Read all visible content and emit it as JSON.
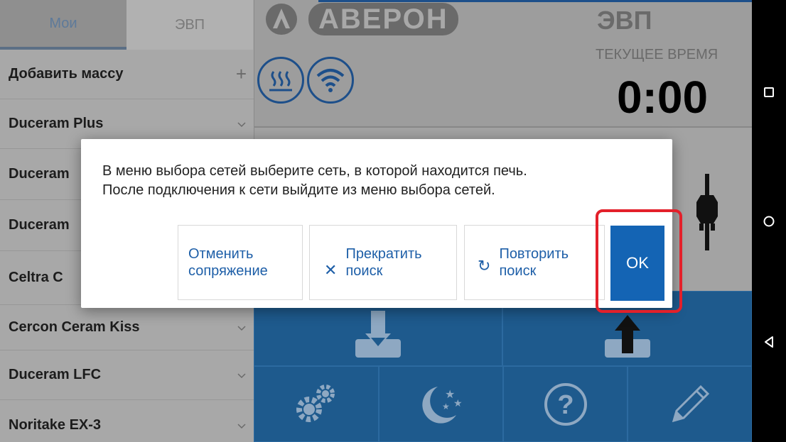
{
  "sidebar": {
    "tabs": [
      {
        "label": "Мои"
      },
      {
        "label": "ЭВП"
      }
    ],
    "items": [
      {
        "label": "Добавить массу",
        "icon": "plus-icon"
      },
      {
        "label": "Duceram Plus",
        "icon": "chevron-down-icon"
      },
      {
        "label": "Duceram",
        "icon": "chevron-down-icon"
      },
      {
        "label": "Duceram",
        "icon": "chevron-down-icon"
      },
      {
        "label": "Celtra C",
        "icon": "chevron-down-icon"
      },
      {
        "label": "Cercon Ceram Kiss",
        "icon": "chevron-down-icon"
      },
      {
        "label": "Duceram LFC",
        "icon": "chevron-down-icon"
      },
      {
        "label": "Noritake EX-3",
        "icon": "chevron-down-icon"
      }
    ]
  },
  "header": {
    "brand": "АВЕРОН",
    "device": "ЭВП",
    "time_label": "ТЕКУЩЕЕ ВРЕМЯ",
    "time_value": "0:00",
    "status_icons": [
      "heater-icon",
      "wifi-icon"
    ]
  },
  "toolbar": {
    "buttons": [
      "download-icon",
      "upload-icon",
      "settings-icon",
      "night-mode-icon",
      "help-icon",
      "edit-icon"
    ]
  },
  "dialog": {
    "message_line1": "В меню выбора сетей выберите сеть, в которой находится печь.",
    "message_line2": "После подключения к сети выйдите из меню выбора сетей.",
    "cancel_line1": "Отменить",
    "cancel_line2": "сопряжение",
    "stop_line1": "Прекратить",
    "stop_line2": "поиск",
    "retry_line1": "Повторить",
    "retry_line2": "поиск",
    "ok": "OK"
  },
  "colors": {
    "accent": "#1464b4",
    "highlight": "#e3202a",
    "panel_blue": "#1e5a8d"
  }
}
